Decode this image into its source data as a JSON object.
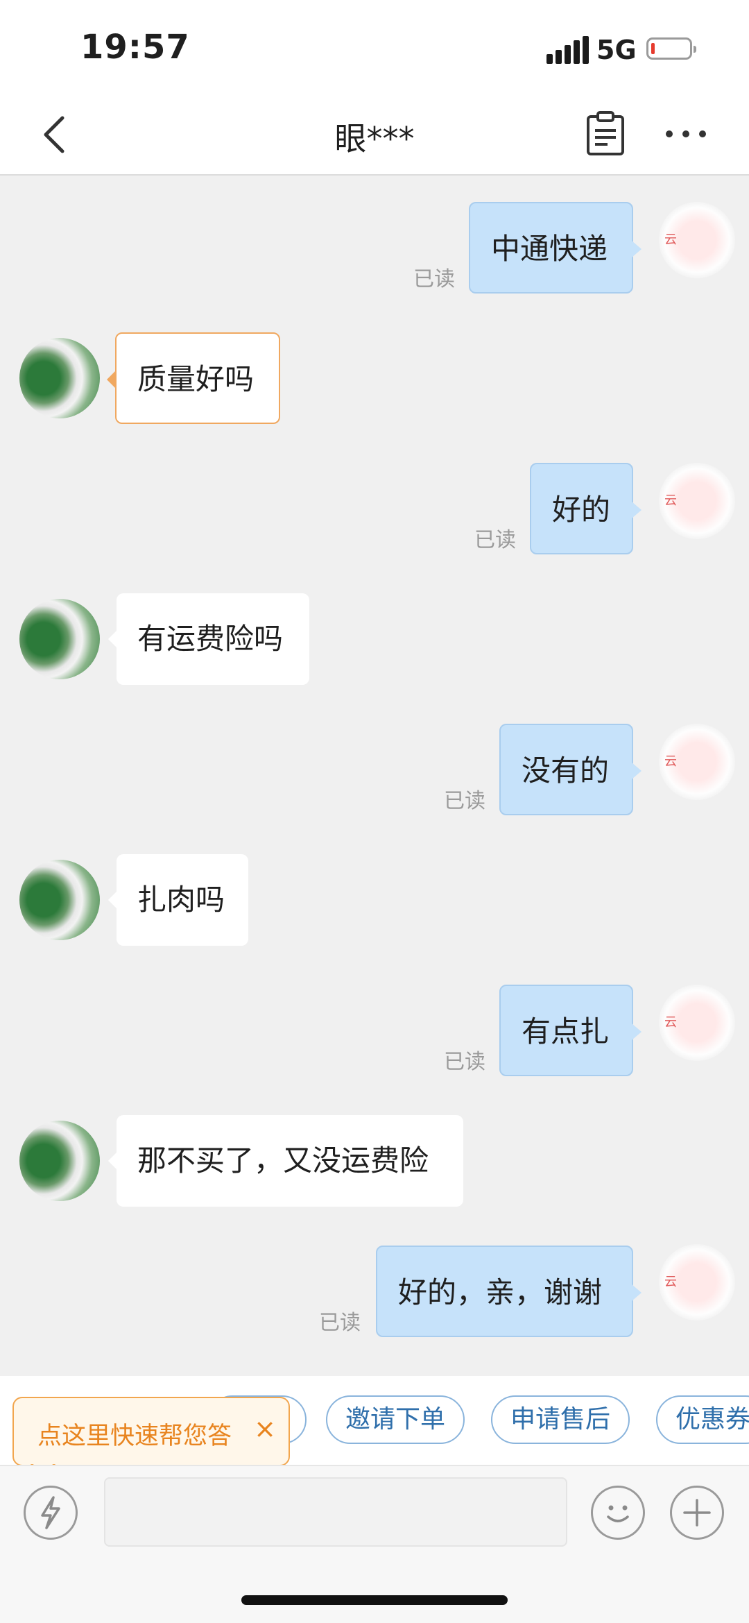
{
  "status_bar": {
    "time": "19:57",
    "network": "5G",
    "battery_color": "#e63b2e"
  },
  "nav": {
    "title": "眼***",
    "back_icon": "chevron-left-icon",
    "clipboard_icon": "clipboard-icon",
    "more_icon": "more-icon"
  },
  "messages": [
    {
      "side": "out",
      "text": "中通快递",
      "status": "已读"
    },
    {
      "side": "in",
      "text": "质量好吗"
    },
    {
      "side": "out",
      "text": "好的",
      "status": "已读"
    },
    {
      "side": "in",
      "text": "有运费险吗"
    },
    {
      "side": "out",
      "text": "没有的",
      "status": "已读"
    },
    {
      "side": "in",
      "text": "扎肉吗"
    },
    {
      "side": "out",
      "text": "有点扎",
      "status": "已读"
    },
    {
      "side": "in",
      "text": "那不买了，又没运费险"
    },
    {
      "side": "out",
      "text": "好的，亲，谢谢",
      "status": "已读"
    }
  ],
  "quick_replies": [
    "邀请下单",
    "申请售后",
    "优惠券"
  ],
  "tip": {
    "text": "点这里快速帮您答",
    "close": "×"
  },
  "input": {
    "placeholder": "",
    "value": ""
  },
  "colors": {
    "out_bubble": "#c6e2fa",
    "chip_text": "#2f6fab",
    "tip_accent": "#e8841f",
    "background": "#f0f0f0"
  }
}
